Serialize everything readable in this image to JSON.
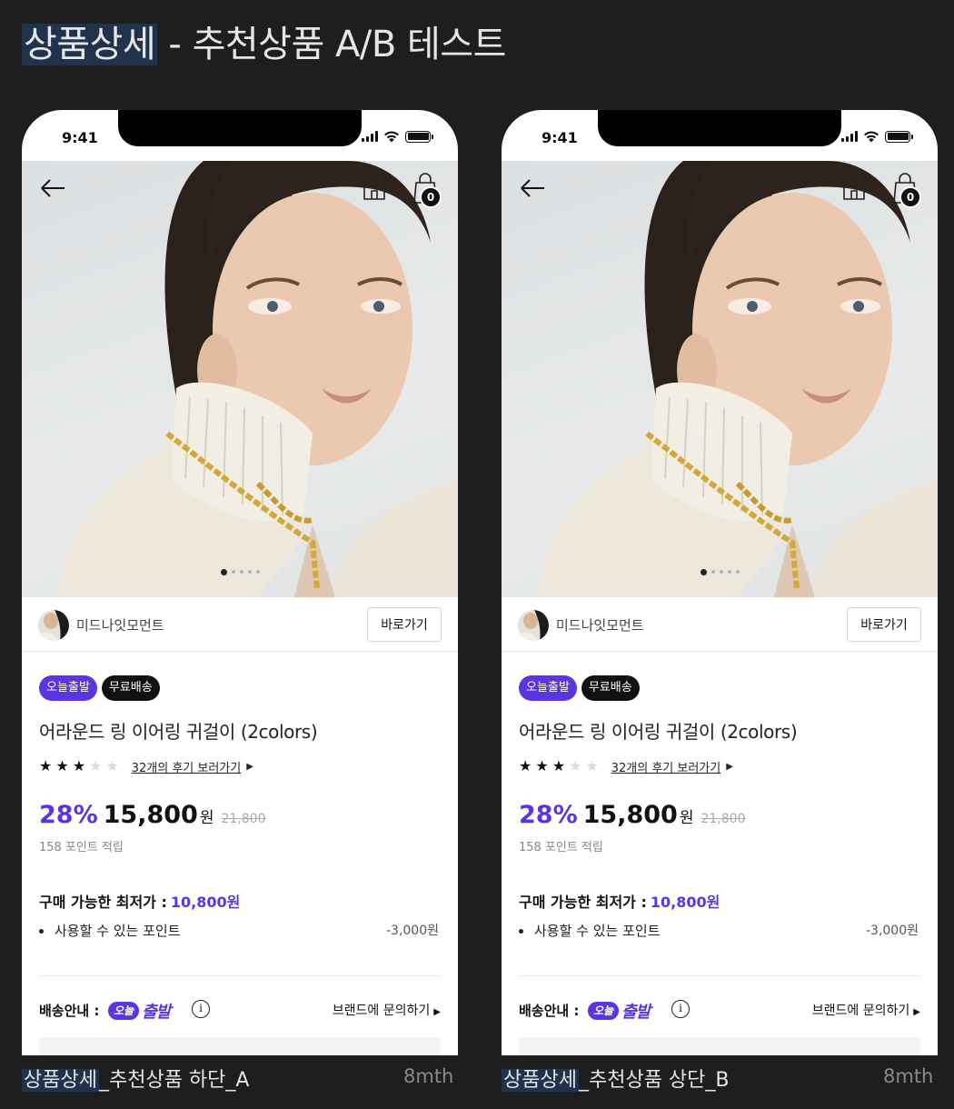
{
  "page": {
    "title_highlight": "상품상세",
    "title_rest": " - 추천상품 A/B 테스트"
  },
  "frames": [
    {
      "caption_highlight": "상품상세",
      "caption_rest": "_추천상품 하단_A",
      "meta": "8mth"
    },
    {
      "caption_highlight": "상품상세",
      "caption_rest": "_추천상품 상단_B",
      "meta": "8mth"
    }
  ],
  "status_bar": {
    "time": "9:41"
  },
  "header": {
    "cart_count": "0",
    "icons": [
      "back-arrow-icon",
      "home-icon",
      "shopping-bag-icon"
    ]
  },
  "brand": {
    "name": "미드나잇모먼트",
    "goto_label": "바로가기"
  },
  "badges": {
    "today": "오늘출발",
    "free": "무료배송"
  },
  "product": {
    "name": "어라운드 링 이어링 귀걸이 (2colors)",
    "rating": 3,
    "rating_max": 5,
    "review_link": "32개의 후기 보러가기",
    "discount": "28%",
    "price": "15,800",
    "currency": "원",
    "original_price": "21,800",
    "points_note": "158 포인트 적립"
  },
  "lowest_price": {
    "label": "구매 가능한 최저가 :",
    "value": "10,800원",
    "bullet_label": "사용할 수 있는 포인트",
    "bullet_amount": "-3,000원"
  },
  "shipping": {
    "label": "배송안내 :",
    "logo_pill": "오늘",
    "logo_text": "출발",
    "inquiry": "브랜드에 문의하기"
  },
  "gallery": {
    "dots": 5,
    "active": 0
  },
  "colors": {
    "accent": "#5b34e4",
    "badge_dark": "#111111"
  }
}
